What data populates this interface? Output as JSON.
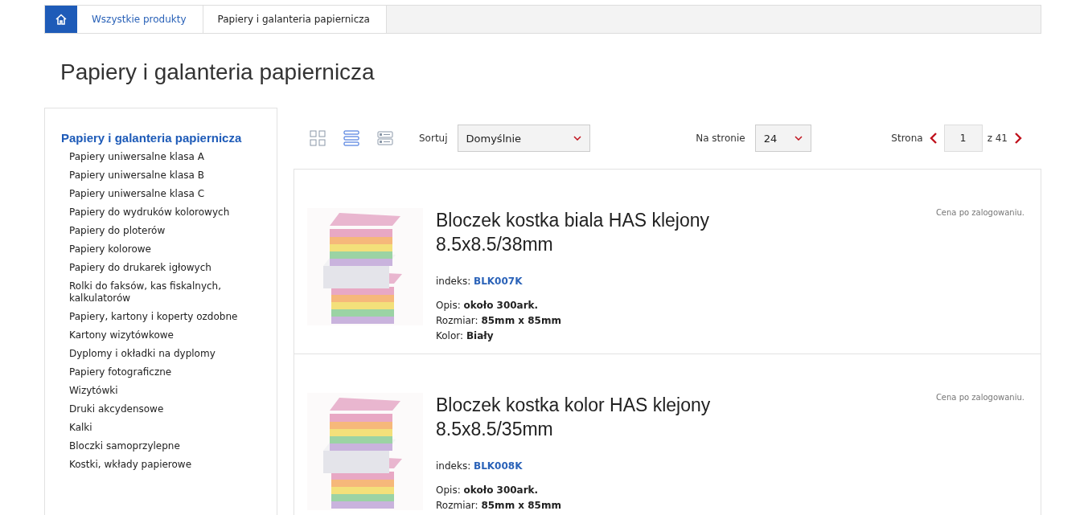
{
  "breadcrumb": [
    {
      "label": "Wszystkie produkty",
      "kind": "link"
    },
    {
      "label": "Papiery i galanteria papiernicza",
      "kind": "current"
    }
  ],
  "title": "Papiery i galanteria papiernicza",
  "sidebar": {
    "heading": "Papiery i galanteria papiernicza",
    "items": [
      "Papiery uniwersalne klasa A",
      "Papiery uniwersalne klasa B",
      "Papiery uniwersalne klasa C",
      "Papiery do wydruków kolorowych",
      "Papiery do ploterów",
      "Papiery kolorowe",
      "Papiery do drukarek igłowych",
      "Rolki do faksów, kas fiskalnych, kalkulatorów",
      "Papiery, kartony i koperty ozdobne",
      "Kartony wizytówkowe",
      "Dyplomy i okładki na dyplomy",
      "Papiery fotograficzne",
      "Wizytówki",
      "Druki akcydensowe",
      "Kalki",
      "Bloczki samoprzylepne",
      "Kostki, wkłady papierowe"
    ]
  },
  "toolbar": {
    "view_modes": [
      {
        "kind": "grid",
        "selected": false
      },
      {
        "kind": "list",
        "selected": true
      },
      {
        "kind": "details",
        "selected": false
      }
    ],
    "sort_label": "Sortuj",
    "sort_value": "Domyślnie",
    "per_page_label": "Na stronie",
    "per_page_value": "24",
    "page_label": "Strona",
    "page_value": "1",
    "page_total": "z 41"
  },
  "products": [
    {
      "name": "Bloczek kostka biala HAS klejony 8.5x8.5/38mm",
      "price_note": "Cena po zalogowaniu.",
      "index_label": "indeks:",
      "index": "BLK007K",
      "details": [
        {
          "label": "Opis:",
          "value": "około 300ark."
        },
        {
          "label": "Rozmiar:",
          "value": "85mm x 85mm"
        },
        {
          "label": "Kolor:",
          "value": "Biały"
        }
      ]
    },
    {
      "name": "Bloczek kostka kolor HAS klejony 8.5x8.5/35mm",
      "price_note": "Cena po zalogowaniu.",
      "index_label": "indeks:",
      "index": "BLK008K",
      "details": [
        {
          "label": "Opis:",
          "value": "około 300ark."
        },
        {
          "label": "Rozmiar:",
          "value": "85mm x 85mm"
        }
      ]
    }
  ]
}
